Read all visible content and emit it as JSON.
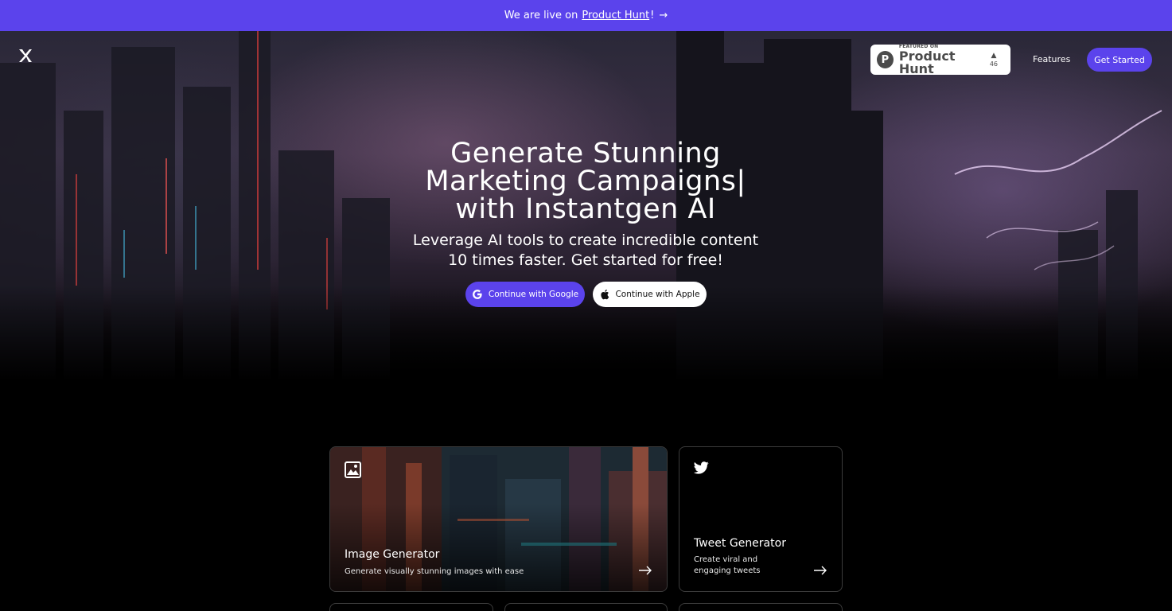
{
  "banner": {
    "prefix": "We are live on",
    "link": "Product Hunt",
    "suffix": "!",
    "arrow": "→"
  },
  "header": {
    "logo_icon": "instantgen-x-logo-icon",
    "product_hunt_badge": {
      "featured_label": "FEATURED ON",
      "name": "Product Hunt",
      "letter": "P",
      "upvote_icon": "▲",
      "votes": "46"
    },
    "nav_features": "Features",
    "get_started": "Get Started"
  },
  "hero": {
    "headline_line1": "Generate Stunning",
    "headline_line2": "Marketing Campaigns|",
    "headline_line3": "with Instantgen AI",
    "subheadline": "Leverage AI tools to create incredible content 10 times faster. Get started for free!",
    "google_button": "Continue with Google",
    "apple_button": "Continue with Apple"
  },
  "cards": [
    {
      "icon": "image-icon",
      "title": "Image Generator",
      "description": "Generate visually stunning images with ease"
    },
    {
      "icon": "twitter-bird-icon",
      "title": "Tweet Generator",
      "description": "Create viral and engaging tweets"
    }
  ],
  "colors": {
    "accent": "#5b43ec",
    "background": "#000000",
    "card_border": "#3b3b3b"
  }
}
